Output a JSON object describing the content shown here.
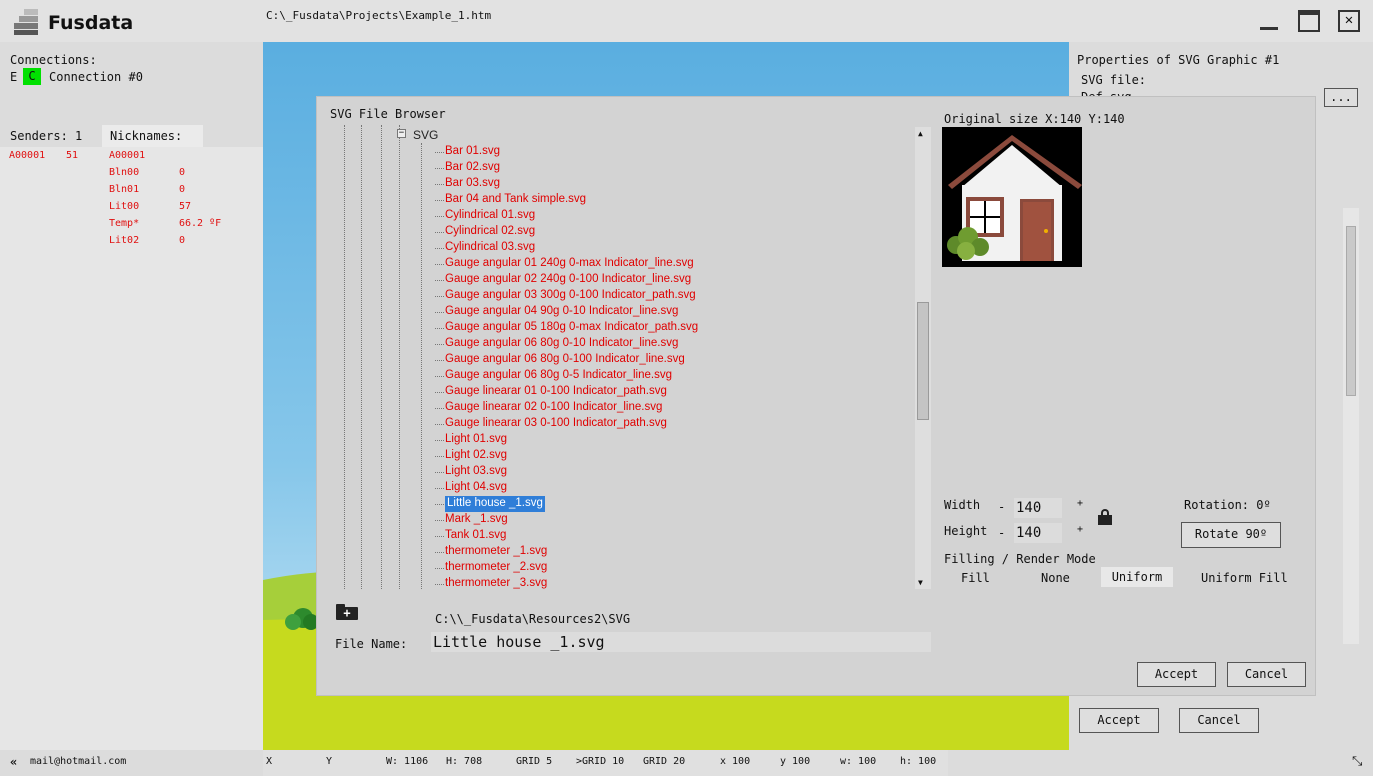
{
  "app": {
    "title": "Fusdata",
    "file_path": "C:\\_Fusdata\\Projects\\Example_1.htm"
  },
  "left": {
    "connections_label": "Connections:",
    "conn_e": "E",
    "conn_c": "C",
    "conn_name": "Connection #0",
    "senders_label": "Senders: 1",
    "nicknames_label": "Nicknames:",
    "sender": {
      "id": "A00001",
      "value": "51"
    },
    "nicknames": [
      {
        "name": "A00001",
        "value": ""
      },
      {
        "name": "Bln00",
        "value": "0"
      },
      {
        "name": "Bln01",
        "value": "0"
      },
      {
        "name": "Lit00",
        "value": "57"
      },
      {
        "name": "Temp*",
        "value": "66.2 ºF"
      },
      {
        "name": "Lit02",
        "value": "0"
      }
    ]
  },
  "props": {
    "title": "Properties of SVG Graphic #1",
    "svg_file_label": "SVG file:",
    "svg_file_value": "Def.svg",
    "browse_label": "...",
    "accept": "Accept",
    "cancel": "Cancel"
  },
  "dialog": {
    "title": "SVG File Browser",
    "tree_root": "SVG",
    "files": [
      "Bar 01.svg",
      "Bar 02.svg",
      "Bar 03.svg",
      "Bar 04 and Tank simple.svg",
      "Cylindrical 01.svg",
      "Cylindrical 02.svg",
      "Cylindrical 03.svg",
      "Gauge angular 01 240g 0-max Indicator_line.svg",
      "Gauge angular 02 240g 0-100 Indicator_line.svg",
      "Gauge angular 03 300g 0-100 Indicator_path.svg",
      "Gauge angular 04 90g 0-10 Indicator_line.svg",
      "Gauge angular 05 180g 0-max Indicator_path.svg",
      "Gauge angular 06 80g 0-10 Indicator_line.svg",
      "Gauge angular 06 80g 0-100 Indicator_line.svg",
      "Gauge angular 06 80g 0-5 Indicator_line.svg",
      "Gauge linearar 01 0-100 Indicator_path.svg",
      "Gauge linearar 02 0-100 Indicator_line.svg",
      "Gauge linearar 03 0-100 Indicator_path.svg",
      "Light 01.svg",
      "Light 02.svg",
      "Light 03.svg",
      "Light 04.svg",
      "Little house _1.svg",
      "Mark _1.svg",
      "Tank 01.svg",
      "thermometer _1.svg",
      "thermometer _2.svg",
      "thermometer _3.svg"
    ],
    "selected_index": 22,
    "original_size": "Original size X:140 Y:140",
    "width_label": "Width",
    "height_label": "Height",
    "width_value": "140",
    "height_value": "140",
    "minus": "-",
    "plus": "+",
    "rotation_label": "Rotation: 0º",
    "rotate_button": "Rotate 90º",
    "filling_label": "Filling / Render Mode",
    "modes": [
      "Fill",
      "None",
      "Uniform",
      "Uniform Fill"
    ],
    "active_mode": "Uniform",
    "folder_path": "C:\\\\_Fusdata\\Resources2\\SVG",
    "file_name_label": "File Name:",
    "file_name_value": "Little house _1.svg",
    "accept": "Accept",
    "cancel": "Cancel"
  },
  "status": {
    "email": "mail@hotmail.com",
    "x": "X",
    "y": "Y",
    "w": "W: 1106",
    "h": "H: 708",
    "grid5": "GRID 5",
    "grid10": ">GRID 10",
    "grid20": "GRID 20",
    "x100": "x 100",
    "y100": "y 100",
    "wsmall": "w: 100",
    "hsmall": "h: 100"
  },
  "colors": {
    "accent": "#2f7ed8",
    "connected": "#00e000",
    "error_text": "#e01010"
  }
}
